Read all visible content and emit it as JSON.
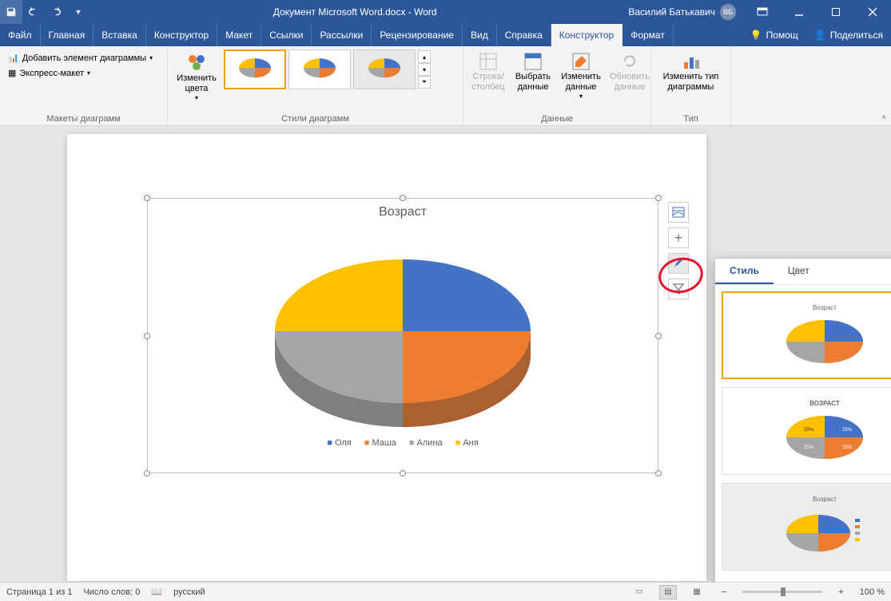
{
  "title": "Документ Microsoft Word.docx  -  Word",
  "user": {
    "name": "Василий Батькавич",
    "initials": "ВБ"
  },
  "tabs": {
    "file": "Файл",
    "items": [
      "Главная",
      "Вставка",
      "Конструктор",
      "Макет",
      "Ссылки",
      "Рассылки",
      "Рецензирование",
      "Вид",
      "Справка",
      "Конструктор",
      "Формат"
    ],
    "active_index": 9,
    "help": "Помощ",
    "share": "Поделиться"
  },
  "ribbon": {
    "group1": {
      "add_element": "Добавить элемент диаграммы",
      "quick_layout": "Экспресс-макет",
      "label": "Макеты диаграмм"
    },
    "group2": {
      "change_colors": "Изменить\nцвета",
      "label": "Стили диаграмм"
    },
    "group3": {
      "switch": "Строка/\nстолбец",
      "select": "Выбрать\nданные",
      "edit": "Изменить\nданные",
      "refresh": "Обновить\nданные",
      "label": "Данные"
    },
    "group4": {
      "change_type": "Изменить тип\nдиаграммы",
      "label": "Тип"
    }
  },
  "chart_data": {
    "type": "pie",
    "title": "Возраст",
    "categories": [
      "Оля",
      "Маша",
      "Алина",
      "Аня"
    ],
    "values": [
      25,
      25,
      25,
      25
    ],
    "colors": [
      "#4472c4",
      "#ed7d31",
      "#a5a5a5",
      "#ffc000"
    ]
  },
  "float": {
    "layout": "layout",
    "add": "add",
    "style": "style",
    "filter": "filter"
  },
  "flyout": {
    "tab_style": "Стиль",
    "tab_color": "Цвет",
    "thumb_title": "Возраст",
    "thumb_title_caps": "ВОЗРАСТ"
  },
  "status": {
    "page": "Страница 1 из 1",
    "words": "Число слов: 0",
    "lang": "русский",
    "zoom": "100 %"
  }
}
